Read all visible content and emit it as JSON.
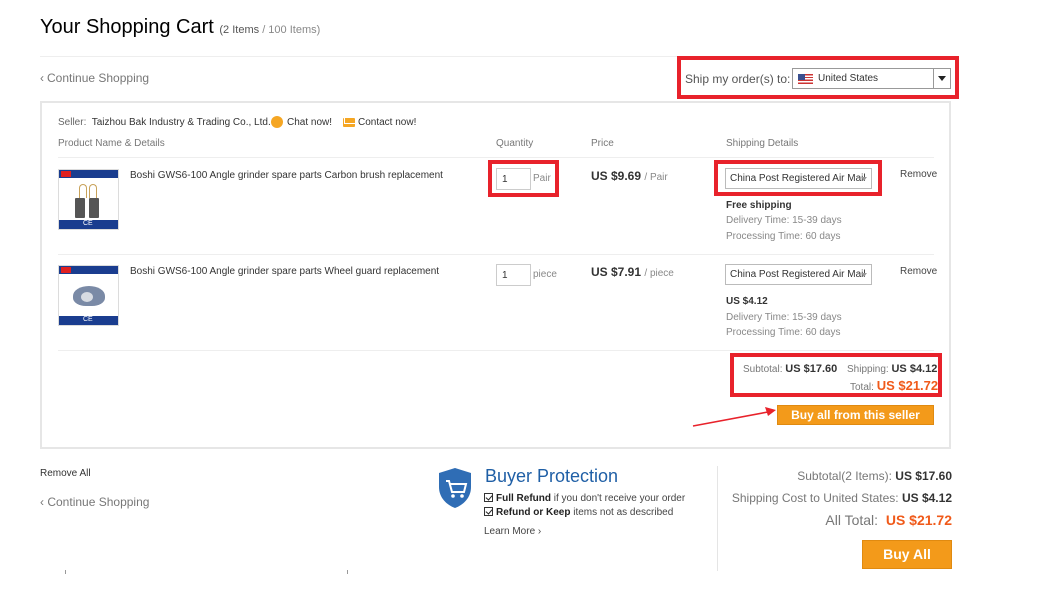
{
  "header": {
    "title": "Your Shopping Cart",
    "count_open": "(2 Items",
    "count_total": "/ 100 Items)"
  },
  "nav": {
    "continue_shopping": "Continue Shopping"
  },
  "ship_to": {
    "label": "Ship my order(s) to:",
    "country": "United States"
  },
  "seller": {
    "label": "Seller:",
    "name": "Taizhou Bak Industry & Trading Co., Ltd.",
    "chat": "Chat now!",
    "contact": "Contact now!"
  },
  "columns": {
    "product": "Product Name & Details",
    "quantity": "Quantity",
    "price": "Price",
    "shipping": "Shipping Details"
  },
  "items": [
    {
      "name": "Boshi GWS6-100 Angle grinder spare parts Carbon brush replacement",
      "quantity": "1",
      "unit": "Pair",
      "price": "US $9.69",
      "price_unit": "/ Pair",
      "shipping_method": "China Post Registered Air Mail",
      "shipping_cost": "Free shipping",
      "delivery_time": "Delivery Time: 15-39 days",
      "processing_time": "Processing Time: 60 days",
      "remove": "Remove"
    },
    {
      "name": "Boshi GWS6-100 Angle grinder spare parts Wheel guard replacement",
      "quantity": "1",
      "unit": "piece",
      "price": "US $7.91",
      "price_unit": "/ piece",
      "shipping_method": "China Post Registered Air Mail",
      "shipping_cost": "US $4.12",
      "delivery_time": "Delivery Time: 15-39 days",
      "processing_time": "Processing Time: 60 days",
      "remove": "Remove"
    }
  ],
  "seller_summary": {
    "subtotal_label": "Subtotal:",
    "subtotal": "US $17.60",
    "shipping_label": "Shipping:",
    "shipping": "US $4.12",
    "total_label": "Total:",
    "total": "US $21.72",
    "buy_button": "Buy all from this seller"
  },
  "footer": {
    "remove_all": "Remove All",
    "continue_shopping": "Continue Shopping"
  },
  "buyer_protection": {
    "title": "Buyer Protection",
    "item1_bold": "Full Refund",
    "item1_rest": "if you don't receive your order",
    "item2_bold": "Refund or Keep",
    "item2_rest": "items not as described",
    "learn_more": "Learn More"
  },
  "order_summary": {
    "subtotal_label": "Subtotal(2 Items):",
    "subtotal": "US $17.60",
    "shipping_label": "Shipping Cost to United States:",
    "shipping": "US $4.12",
    "total_label": "All Total:",
    "total": "US $21.72",
    "buy_all": "Buy All"
  },
  "colors": {
    "accent_orange": "#f39a1a",
    "highlight_red": "#e8222b",
    "total_orange": "#f05a1a",
    "protection_blue": "#1f5fa6"
  }
}
